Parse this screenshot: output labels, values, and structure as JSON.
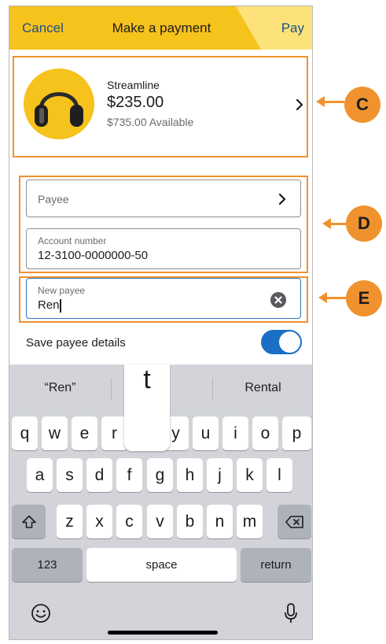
{
  "nav": {
    "cancel": "Cancel",
    "title": "Make a payment",
    "pay": "Pay"
  },
  "account": {
    "name": "Streamline",
    "balance": "$235.00",
    "available": "$735.00 Available"
  },
  "form": {
    "payee_label": "Payee",
    "account_number_label": "Account number",
    "account_number_value": "12-3100-0000000-50",
    "new_payee_label": "New payee",
    "new_payee_value": "Ren",
    "save_label": "Save payee details",
    "save_enabled": true
  },
  "keyboard": {
    "suggestions": [
      "“Ren”",
      "t",
      "Rental"
    ],
    "popup": "t",
    "row1": [
      "q",
      "w",
      "e",
      "r",
      "t",
      "y",
      "u",
      "i",
      "o",
      "p"
    ],
    "row2": [
      "a",
      "s",
      "d",
      "f",
      "g",
      "h",
      "j",
      "k",
      "l"
    ],
    "row3": [
      "z",
      "x",
      "c",
      "v",
      "b",
      "n",
      "m"
    ],
    "numbers": "123",
    "space": "space",
    "return": "return"
  },
  "callouts": [
    "C",
    "D",
    "E"
  ],
  "colors": {
    "nav_yellow": "#f6c21c",
    "accent_orange": "#f0922d",
    "link_blue": "#1d4f86",
    "toggle_blue": "#1a6fc5"
  },
  "icons": [
    "chevron-right-icon",
    "clear-icon",
    "shift-icon",
    "backspace-icon",
    "emoji-icon",
    "microphone-icon",
    "headphones-icon"
  ]
}
